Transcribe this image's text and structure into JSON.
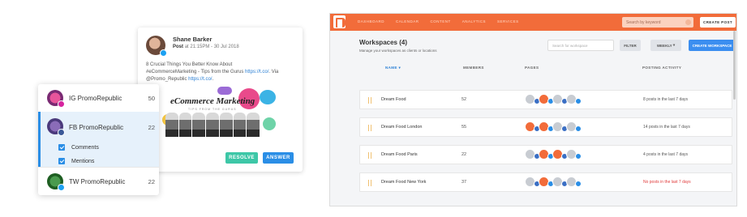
{
  "post": {
    "author": "Shane Barker",
    "status": "Post",
    "datetime": "at 21:15PM - 30 Jul 2018",
    "text_line1": "8 Crucial Things You Better Know About",
    "text_line2_pre": "#eCommerceMarketing - Tips from the Gurus ",
    "text_line2_link": "https://t.co/",
    "text_line2_post": ". Via",
    "text_line3_pre": "@Promo_Republic ",
    "text_line3_link": "https://t.co/",
    "text_line3_post": ".",
    "image_title": "eCommerce Marketing",
    "image_sub": "TIPS FROM THE GURUS",
    "resolve_label": "RESOLVE",
    "answer_label": "ANSWER"
  },
  "accounts": [
    {
      "name": "IG PromoRepublic",
      "count": "50",
      "network": "instagram"
    },
    {
      "name": "FB PromoRepublic",
      "count": "22",
      "network": "facebook",
      "options": [
        "Comments",
        "Mentions"
      ]
    },
    {
      "name": "TW PromoRepublic",
      "count": "22",
      "network": "twitter"
    }
  ],
  "nav": {
    "items": [
      "DASHBOARD",
      "CALENDAR",
      "CONTENT",
      "ANALYTICS",
      "SERVICES"
    ],
    "search_placeholder": "Search by keyword",
    "create_post": "CREATE POST"
  },
  "workspaces": {
    "title": "Workspaces (4)",
    "subtitle": "Manage your workspaces as clients or locations",
    "search_placeholder": "Search for workspace",
    "filter": "FILTER",
    "period": "WEEKLY",
    "create": "CREATE WORKSPACE",
    "columns": {
      "name": "NAME ▾",
      "members": "MEMBERS",
      "pages": "PAGES",
      "activity": "POSTING ACTIVITY"
    },
    "rows": [
      {
        "name": "Dream Food",
        "members": "52",
        "activity": "8 posts in the last 7 days"
      },
      {
        "name": "Dream Food London",
        "members": "55",
        "activity": "14 posts in the last 7 days"
      },
      {
        "name": "Dream Food Paris",
        "members": "22",
        "activity": "4 posts in the last 7 days"
      },
      {
        "name": "Dream Food New York",
        "members": "37",
        "activity": "No posts in the last 7 days"
      }
    ]
  },
  "colors": {
    "brand_orange": "#f26c3a",
    "accent_blue": "#2a8ee6",
    "resolve_green": "#3dc7a7",
    "warning_red": "#e03b3b"
  }
}
